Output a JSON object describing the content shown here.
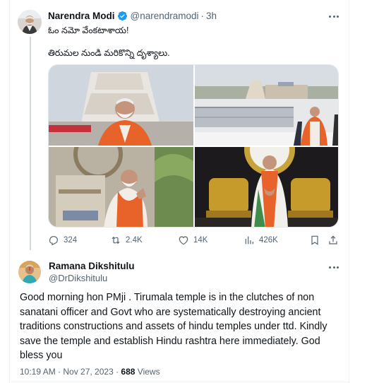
{
  "tweet": {
    "author_name": "Narendra Modi",
    "handle": "@narendramodi",
    "separator": "·",
    "time": "3h",
    "text_line1": "ఓం నమో వేంకటాశాయ!",
    "text_line2": "తిరుమల నుండి మరికొన్ని దృశ్యాలు.",
    "actions": {
      "replies": "324",
      "reposts": "2.4K",
      "likes": "14K",
      "views": "426K"
    }
  },
  "reply": {
    "author_name": "Ramana Dikshitulu",
    "handle": "@DrDikshitulu",
    "text_lines": [
      "Good morning hon PMji . Tirumala temple is in the clutches of non",
      "sanatani officer and Govt who are systematically destroying ancient",
      "traditions constructions and assets of hindu temples under ttd. Kindly",
      "save the temple and establish Hindu rashtra here immediately. God",
      "bless you"
    ],
    "timestamp": "10:19 AM · Nov 27, 2023 · ",
    "views_count": "688",
    "views_label": " Views"
  },
  "colors": {
    "verified_blue": "#1d9bf0",
    "secondary_text": "#536471",
    "saffron": "#e8632a"
  },
  "icons": [
    "verified-badge-icon",
    "more-icon",
    "reply-icon",
    "repost-icon",
    "like-icon",
    "views-icon",
    "bookmark-icon",
    "share-icon"
  ]
}
